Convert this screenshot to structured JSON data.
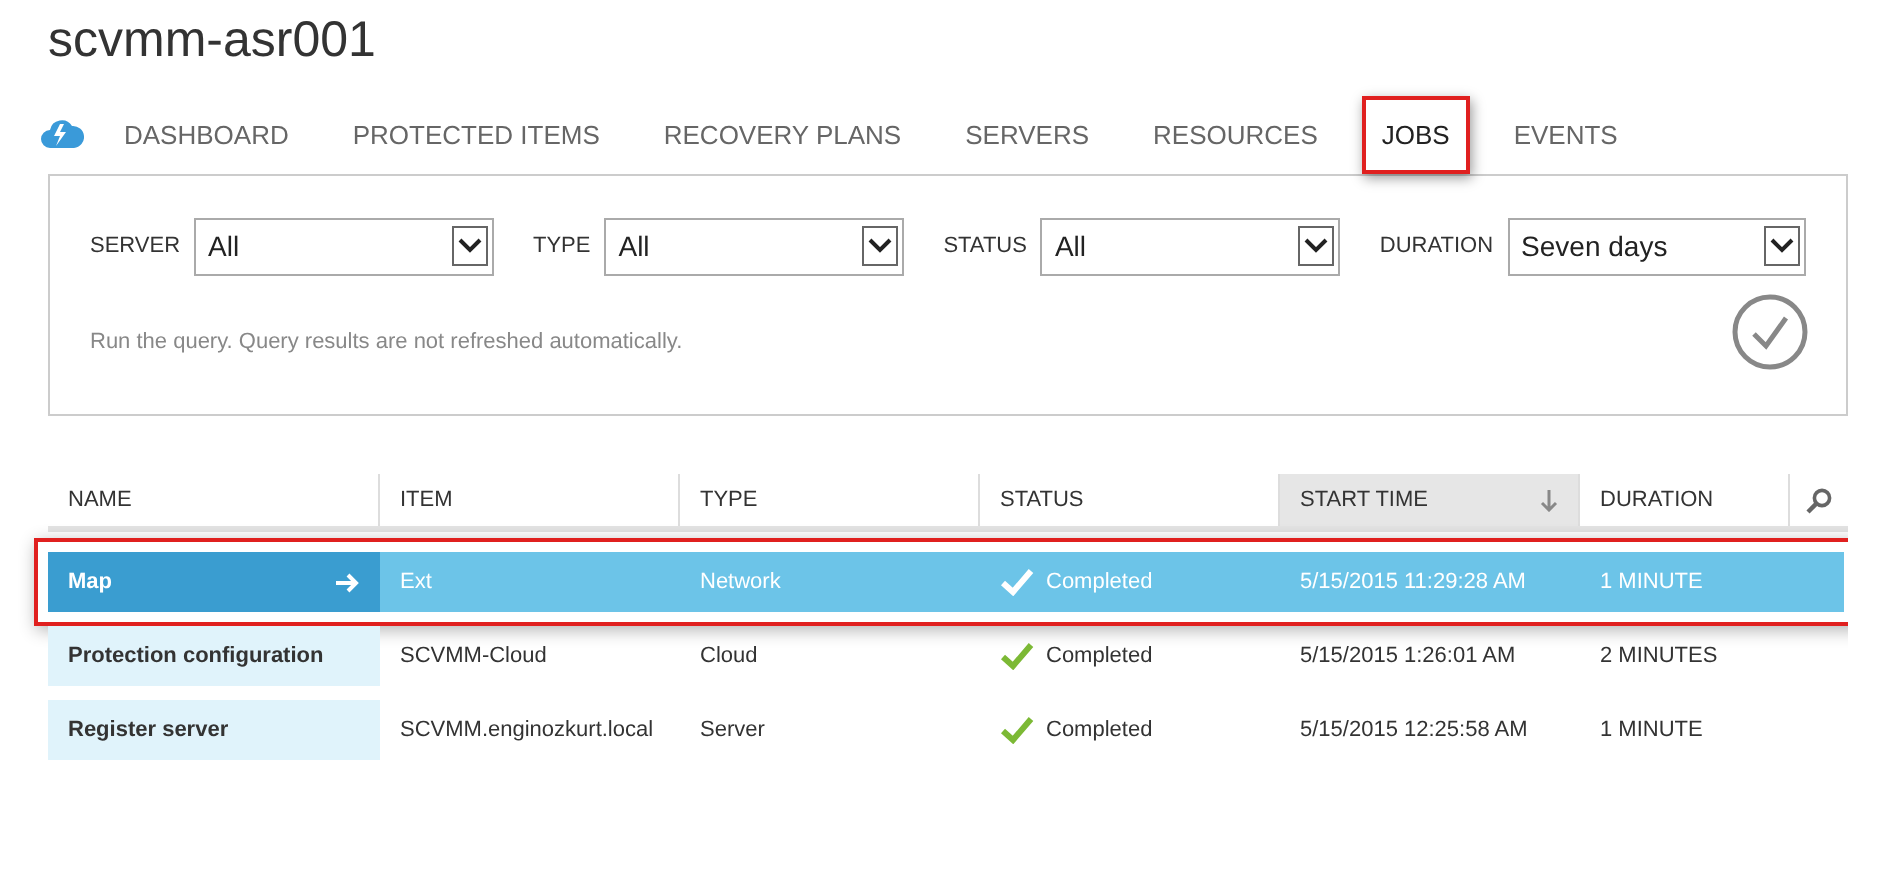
{
  "title": "scvmm-asr001",
  "tabs": [
    {
      "label": "DASHBOARD",
      "selected": false,
      "highlighted": false
    },
    {
      "label": "PROTECTED ITEMS",
      "selected": false,
      "highlighted": false
    },
    {
      "label": "RECOVERY PLANS",
      "selected": false,
      "highlighted": false
    },
    {
      "label": "SERVERS",
      "selected": false,
      "highlighted": false
    },
    {
      "label": "RESOURCES",
      "selected": false,
      "highlighted": false
    },
    {
      "label": "JOBS",
      "selected": true,
      "highlighted": true
    },
    {
      "label": "EVENTS",
      "selected": false,
      "highlighted": false
    }
  ],
  "filters": [
    {
      "label": "SERVER",
      "value": "All"
    },
    {
      "label": "TYPE",
      "value": "All"
    },
    {
      "label": "STATUS",
      "value": "All"
    },
    {
      "label": "DURATION",
      "value": "Seven days"
    }
  ],
  "query_note": "Run the query. Query results are not refreshed automatically.",
  "table": {
    "columns": [
      {
        "label": "NAME",
        "sorted": false
      },
      {
        "label": "ITEM",
        "sorted": false
      },
      {
        "label": "TYPE",
        "sorted": false
      },
      {
        "label": "STATUS",
        "sorted": false
      },
      {
        "label": "START TIME",
        "sorted": true
      },
      {
        "label": "DURATION",
        "sorted": false
      }
    ],
    "rows": [
      {
        "name": "Map",
        "item": "Ext",
        "type": "Network",
        "status": "Completed",
        "start_time": "5/15/2015 11:29:28 AM",
        "duration": "1 MINUTE",
        "selected": true,
        "highlighted": true
      },
      {
        "name": "Protection configuration",
        "item": "SCVMM-Cloud",
        "type": "Cloud",
        "status": "Completed",
        "start_time": "5/15/2015 1:26:01 AM",
        "duration": "2 MINUTES",
        "selected": false,
        "highlighted": false
      },
      {
        "name": "Register server",
        "item": "SCVMM.enginozkurt.local",
        "type": "Server",
        "status": "Completed",
        "start_time": "5/15/2015 12:25:58 AM",
        "duration": "1 MINUTE",
        "selected": false,
        "highlighted": false
      }
    ]
  }
}
